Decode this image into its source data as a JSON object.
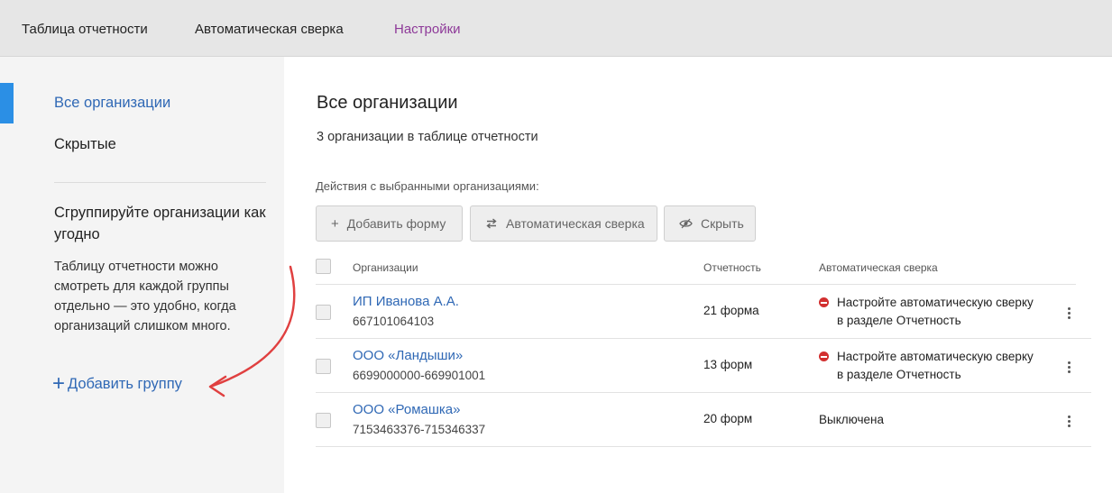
{
  "topbar": {
    "tabs": [
      {
        "label": "Таблица отчетности"
      },
      {
        "label": "Автоматическая сверка"
      },
      {
        "label": "Настройки"
      }
    ],
    "active_color": "#8e3a99"
  },
  "sidebar": {
    "items": [
      {
        "label": "Все организации"
      },
      {
        "label": "Скрытые"
      }
    ],
    "group_title": "Сгруппируйте организации как угодно",
    "group_description": "Таблицу отчетности можно смотреть для каждой группы отдельно — это удобно, когда организаций слишком много.",
    "add_group_label": "Добавить группу",
    "accent_color": "#2b8fe5"
  },
  "main": {
    "title": "Все организации",
    "count_text": "3 организации в таблице отчетности",
    "actions_label": "Действия с выбранными организациями:",
    "buttons": {
      "add_form": "Добавить форму",
      "auto_check": "Автоматическая сверка",
      "hide": "Скрыть"
    },
    "table": {
      "headers": {
        "org": "Организации",
        "reports": "Отчетность",
        "auto": "Автоматическая сверка"
      },
      "rows": [
        {
          "name": "ИП Иванова А.А.",
          "inn": "667101064103",
          "forms": "21 форма",
          "auto_line1": "Настройте автоматическую сверку",
          "auto_line2": "в разделе Отчетность",
          "auto_status": "error"
        },
        {
          "name": "ООО «Ландыши»",
          "inn": "6699000000-669901001",
          "forms": "13 форм",
          "auto_line1": "Настройте автоматическую сверку",
          "auto_line2": "в разделе Отчетность",
          "auto_status": "error"
        },
        {
          "name": "ООО «Ромашка»",
          "inn": "7153463376-715346337",
          "forms": "20 форм",
          "auto_line1": "Выключена",
          "auto_status": "off"
        }
      ]
    }
  },
  "colors": {
    "link": "#2f68b5",
    "error": "#d23030",
    "annotation_arrow": "#e04040"
  }
}
